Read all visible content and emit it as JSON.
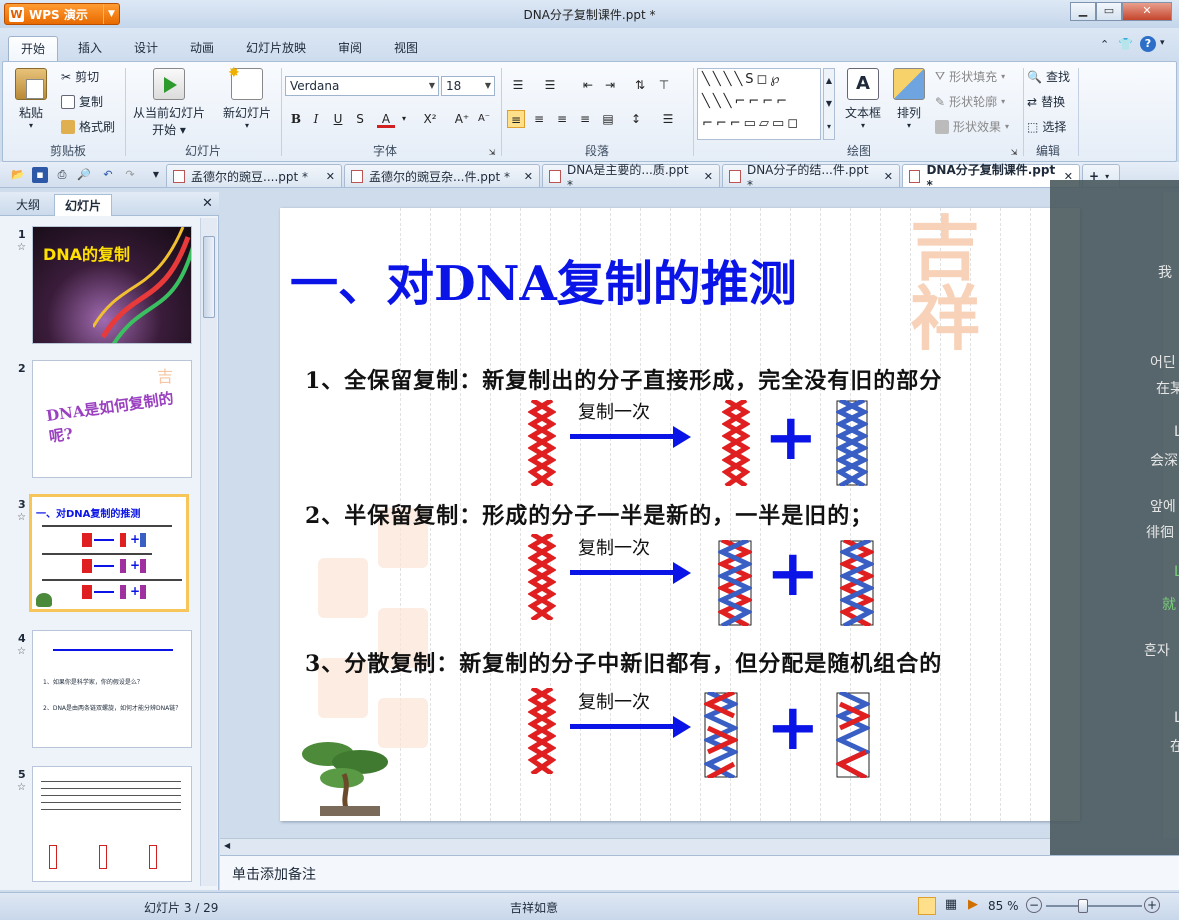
{
  "app": {
    "name": "WPS 演示",
    "logo_letter": "W"
  },
  "window": {
    "title": "DNA分子复制课件.ppt *"
  },
  "ribbon_tabs": [
    "开始",
    "插入",
    "设计",
    "动画",
    "幻灯片放映",
    "审阅",
    "视图"
  ],
  "ribbon": {
    "clipboard": {
      "paste": "粘贴",
      "cut": "剪切",
      "copy": "复制",
      "format_painter": "格式刷",
      "label": "剪贴板"
    },
    "slides": {
      "from_current": "从当前幻灯片",
      "start": "开始",
      "new_slide": "新幻灯片",
      "label": "幻灯片"
    },
    "font": {
      "name": "Verdana",
      "size": "18",
      "label": "字体"
    },
    "paragraph": {
      "label": "段落"
    },
    "drawing": {
      "text_box": "文本框",
      "arrange": "排列",
      "shape_fill": "形状填充",
      "shape_outline": "形状轮廓",
      "shape_effect": "形状效果",
      "label": "绘图"
    },
    "editing": {
      "find": "查找",
      "replace": "替换",
      "select": "选择",
      "label": "编辑"
    }
  },
  "doc_tabs": [
    {
      "label": "孟德尔的豌豆....ppt *"
    },
    {
      "label": "孟德尔的豌豆杂...件.ppt *"
    },
    {
      "label": "DNA是主要的...质.ppt *"
    },
    {
      "label": "DNA分子的结...件.ppt *"
    },
    {
      "label": "DNA分子复制课件.ppt *"
    }
  ],
  "side_tabs": [
    "大纲",
    "幻灯片"
  ],
  "thumbnails": [
    {
      "num": "1",
      "title": "DNA的复制"
    },
    {
      "num": "2",
      "title": "DNA是如何复制的呢?"
    },
    {
      "num": "3",
      "title": "一、对DNA复制的推测"
    },
    {
      "num": "4",
      "title": "",
      "lines": [
        "1、如果你是科学家，你的假设是么？",
        "2、DNA是由两条链双螺旋，如何才能分辨DNA链？"
      ]
    },
    {
      "num": "5",
      "title": ""
    }
  ],
  "slide": {
    "title": "一、对DNA复制的推测",
    "items": [
      "1、全保留复制：新复制出的分子直接形成，完全没有旧的部分",
      "2、半保留复制：形成的分子一半是新的，一半是旧的；",
      "3、分散复制：新复制的分子中新旧都有，但分配是随机组合的"
    ],
    "copy_label": "复制一次"
  },
  "overlay_text": [
    "我",
    "어딘",
    "在某",
    "L",
    "会深",
    "앞에",
    "徘徊",
    "L",
    "就",
    "혼자",
    "L",
    "在"
  ],
  "notes": {
    "placeholder": "单击添加备注"
  },
  "status": {
    "slide_position": "幻灯片 3 / 29",
    "theme": "吉祥如意",
    "zoom": "85 %"
  },
  "colors": {
    "accent_blue": "#0a14e6",
    "helix_red": "#e02020",
    "helix_blue": "#3a5fc4",
    "wps_orange": "#e86a00"
  }
}
